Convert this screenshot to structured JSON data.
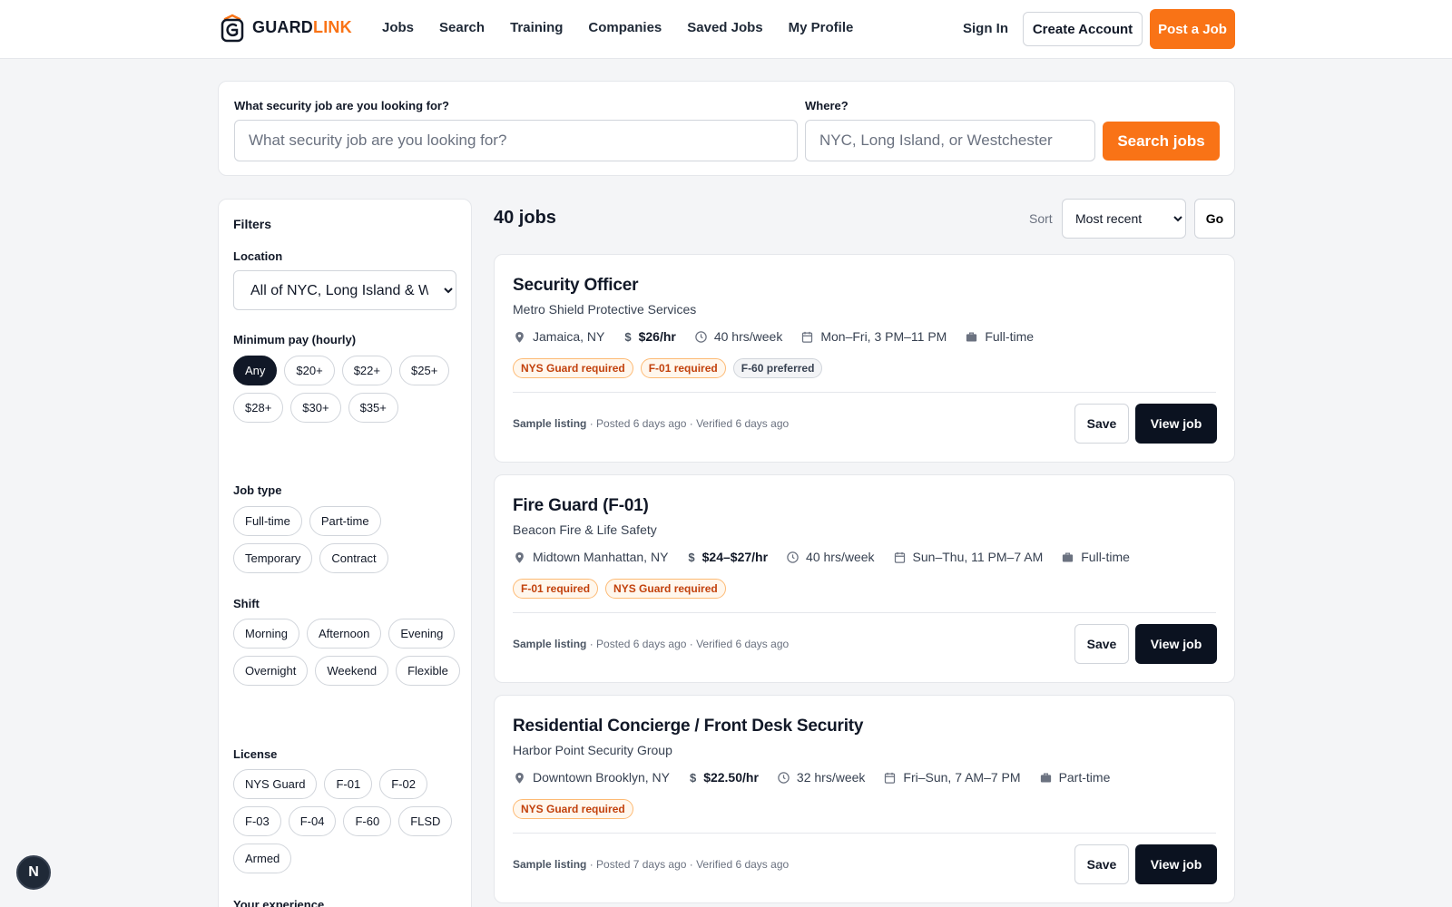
{
  "brand": {
    "part1": "GUARD",
    "part2": "LINK",
    "accent": "#f97316"
  },
  "nav": [
    {
      "label": "Jobs"
    },
    {
      "label": "Search"
    },
    {
      "label": "Training"
    },
    {
      "label": "Companies"
    },
    {
      "label": "Saved Jobs"
    },
    {
      "label": "My Profile"
    }
  ],
  "auth": {
    "sign_in": "Sign In",
    "create_account": "Create Account",
    "post_job": "Post a Job"
  },
  "search": {
    "what_label": "What security job are you looking for?",
    "what_placeholder": "What security job are you looking for?",
    "where_label": "Where?",
    "where_placeholder": "NYC, Long Island, or Westchester",
    "button": "Search jobs"
  },
  "filters": {
    "title": "Filters",
    "location_label": "Location",
    "location_value": "All of NYC, Long Island & Westchester",
    "pay_label": "Minimum pay (hourly)",
    "pay_options": [
      {
        "label": "Any"
      },
      {
        "label": "$20+"
      },
      {
        "label": "$22+"
      },
      {
        "label": "$25+"
      },
      {
        "label": "$28+"
      },
      {
        "label": "$30+"
      },
      {
        "label": "$35+"
      }
    ],
    "pay_selected": "Any",
    "jobtype_label": "Job type",
    "jobtype_options": [
      {
        "label": "Full-time"
      },
      {
        "label": "Part-time"
      },
      {
        "label": "Temporary"
      },
      {
        "label": "Contract"
      }
    ],
    "shift_label": "Shift",
    "shift_options": [
      {
        "label": "Morning"
      },
      {
        "label": "Afternoon"
      },
      {
        "label": "Evening"
      },
      {
        "label": "Overnight"
      },
      {
        "label": "Weekend"
      },
      {
        "label": "Flexible"
      }
    ],
    "license_label": "License",
    "license_options": [
      {
        "label": "NYS Guard"
      },
      {
        "label": "F-01"
      },
      {
        "label": "F-02"
      },
      {
        "label": "F-03"
      },
      {
        "label": "F-04"
      },
      {
        "label": "F-60"
      },
      {
        "label": "FLSD"
      },
      {
        "label": "Armed"
      }
    ],
    "experience_label": "Your experience"
  },
  "results": {
    "count": "40 jobs",
    "sort_label": "Sort",
    "sort_value": "Most recent",
    "go": "Go"
  },
  "jobs": [
    {
      "title": "Security Officer",
      "company": "Metro Shield Protective Services",
      "location": "Jamaica, NY",
      "pay": "$26/hr",
      "hours": "40 hrs/week",
      "schedule": "Mon–Fri, 3 PM–11 PM",
      "type": "Full-time",
      "badges": [
        {
          "label": "NYS Guard required",
          "kind": "req"
        },
        {
          "label": "F-01 required",
          "kind": "req"
        },
        {
          "label": "F-60 preferred",
          "kind": "pref"
        }
      ],
      "sample": "Sample listing",
      "posted": " · Posted 6 days ago · Verified 6 days ago",
      "save": "Save",
      "view": "View job"
    },
    {
      "title": "Fire Guard (F-01)",
      "company": "Beacon Fire & Life Safety",
      "location": "Midtown Manhattan, NY",
      "pay": "$24–$27/hr",
      "hours": "40 hrs/week",
      "schedule": "Sun–Thu, 11 PM–7 AM",
      "type": "Full-time",
      "badges": [
        {
          "label": "F-01 required",
          "kind": "req"
        },
        {
          "label": "NYS Guard required",
          "kind": "req"
        }
      ],
      "sample": "Sample listing",
      "posted": " · Posted 6 days ago · Verified 6 days ago",
      "save": "Save",
      "view": "View job"
    },
    {
      "title": "Residential Concierge / Front Desk Security",
      "company": "Harbor Point Security Group",
      "location": "Downtown Brooklyn, NY",
      "pay": "$22.50/hr",
      "hours": "32 hrs/week",
      "schedule": "Fri–Sun, 7 AM–7 PM",
      "type": "Part-time",
      "badges": [
        {
          "label": "NYS Guard required",
          "kind": "req"
        }
      ],
      "sample": "Sample listing",
      "posted": " · Posted 7 days ago · Verified 6 days ago",
      "save": "Save",
      "view": "View job"
    }
  ],
  "dev_badge": "N"
}
